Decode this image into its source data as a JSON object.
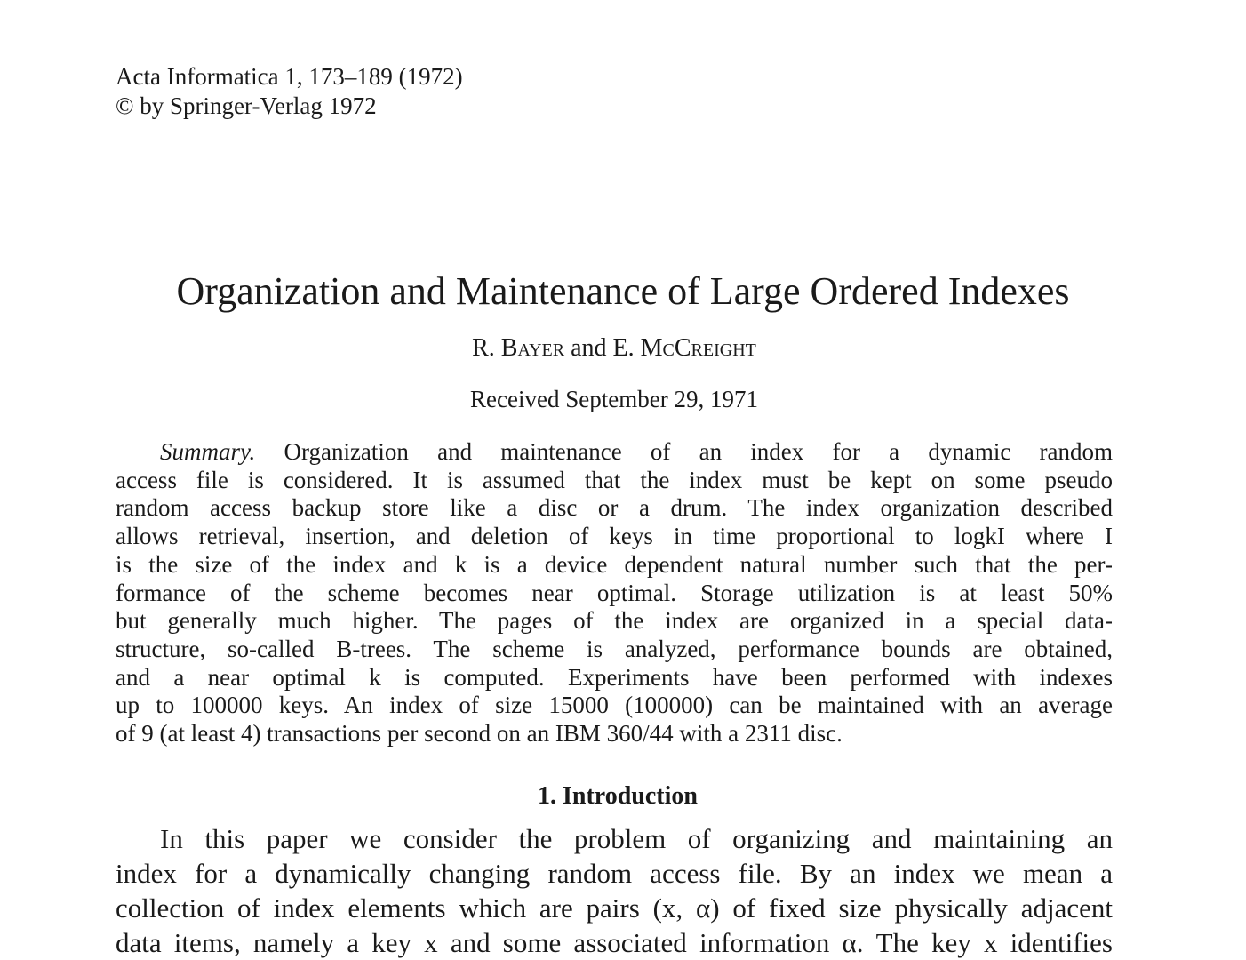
{
  "journal": {
    "citation": "Acta Informatica 1, 173–189 (1972)",
    "copyright": "© by Springer-Verlag 1972"
  },
  "paper": {
    "title": "Organization and Maintenance of Large Ordered Indexes",
    "author1": "R. Bayer",
    "and": "and",
    "author2": "E. McCreight",
    "received": "Received September 29, 1971"
  },
  "summary": {
    "label": "Summary.",
    "lines": [
      "Organization and maintenance of an index for a dynamic random",
      "access file is considered. It is assumed that the index must be kept on some pseudo",
      "random access backup store like a disc or a drum. The index organization described",
      "allows retrieval, insertion, and deletion of keys in time proportional to logkI where I",
      "is the size of the index and k is a device dependent natural number such that the per-",
      "formance of the scheme becomes near optimal. Storage utilization is at least 50%",
      "but generally much higher. The pages of the index are organized in a special data-",
      "structure, so-called B-trees. The scheme is analyzed, performance bounds are obtained,",
      "and a near optimal k is computed. Experiments have been performed with indexes",
      "up to 100000 keys. An index of size 15000 (100000) can be maintained with an average",
      "of 9 (at least 4) transactions per second on an IBM 360/44 with a 2311 disc."
    ]
  },
  "introduction": {
    "heading": "1. Introduction",
    "lines": [
      "In this paper we consider the problem of organizing and maintaining an",
      "index for a dynamically changing random access file. By an index we mean a",
      "collection of index elements which are pairs (x, α) of fixed size physically adjacent",
      "data items, namely a key x and some associated information α. The key x identifies"
    ]
  }
}
